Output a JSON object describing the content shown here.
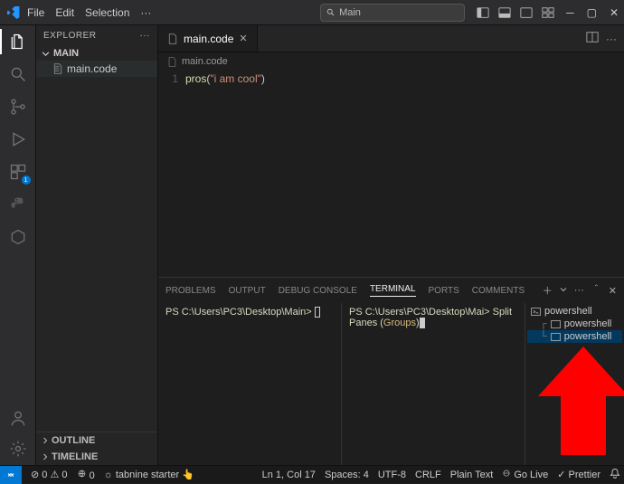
{
  "titlebar": {
    "menus": [
      "File",
      "Edit",
      "Selection"
    ],
    "overflow": "···",
    "search_label": "Main"
  },
  "activity": {
    "ext_badge": "1"
  },
  "sidebar": {
    "title": "EXPLORER",
    "section": "MAIN",
    "file": "main.code",
    "outline": "OUTLINE",
    "timeline": "TIMELINE"
  },
  "tabs": {
    "active": "main.code",
    "crumb": "main.code"
  },
  "code": {
    "line_no": "1",
    "fn": "pros",
    "paren_open": "(",
    "str": "\"i am cool\"",
    "paren_close": ")"
  },
  "panel": {
    "tabs": [
      "PROBLEMS",
      "OUTPUT",
      "DEBUG CONSOLE",
      "TERMINAL",
      "PORTS",
      "COMMENTS"
    ],
    "active_index": 3,
    "term1_prompt": "PS C:\\Users\\PC3\\Desktop\\Main> ",
    "term2_prompt": "PS C:\\Users\\PC3\\Desktop\\Mai> ",
    "term2_cmd_a": "Split Panes (",
    "term2_cmd_b": "Groups",
    "term2_cmd_c": ")",
    "list": [
      "powershell",
      "powershell",
      "powershell"
    ],
    "list_selected": 2
  },
  "status": {
    "errors": "0",
    "warnings": "0",
    "port": "0",
    "tabnine": "tabnine starter",
    "ln_col": "Ln 1, Col 17",
    "spaces": "Spaces: 4",
    "encoding": "UTF-8",
    "eol": "CRLF",
    "lang": "Plain Text",
    "golive": "Go Live",
    "prettier": "Prettier"
  }
}
